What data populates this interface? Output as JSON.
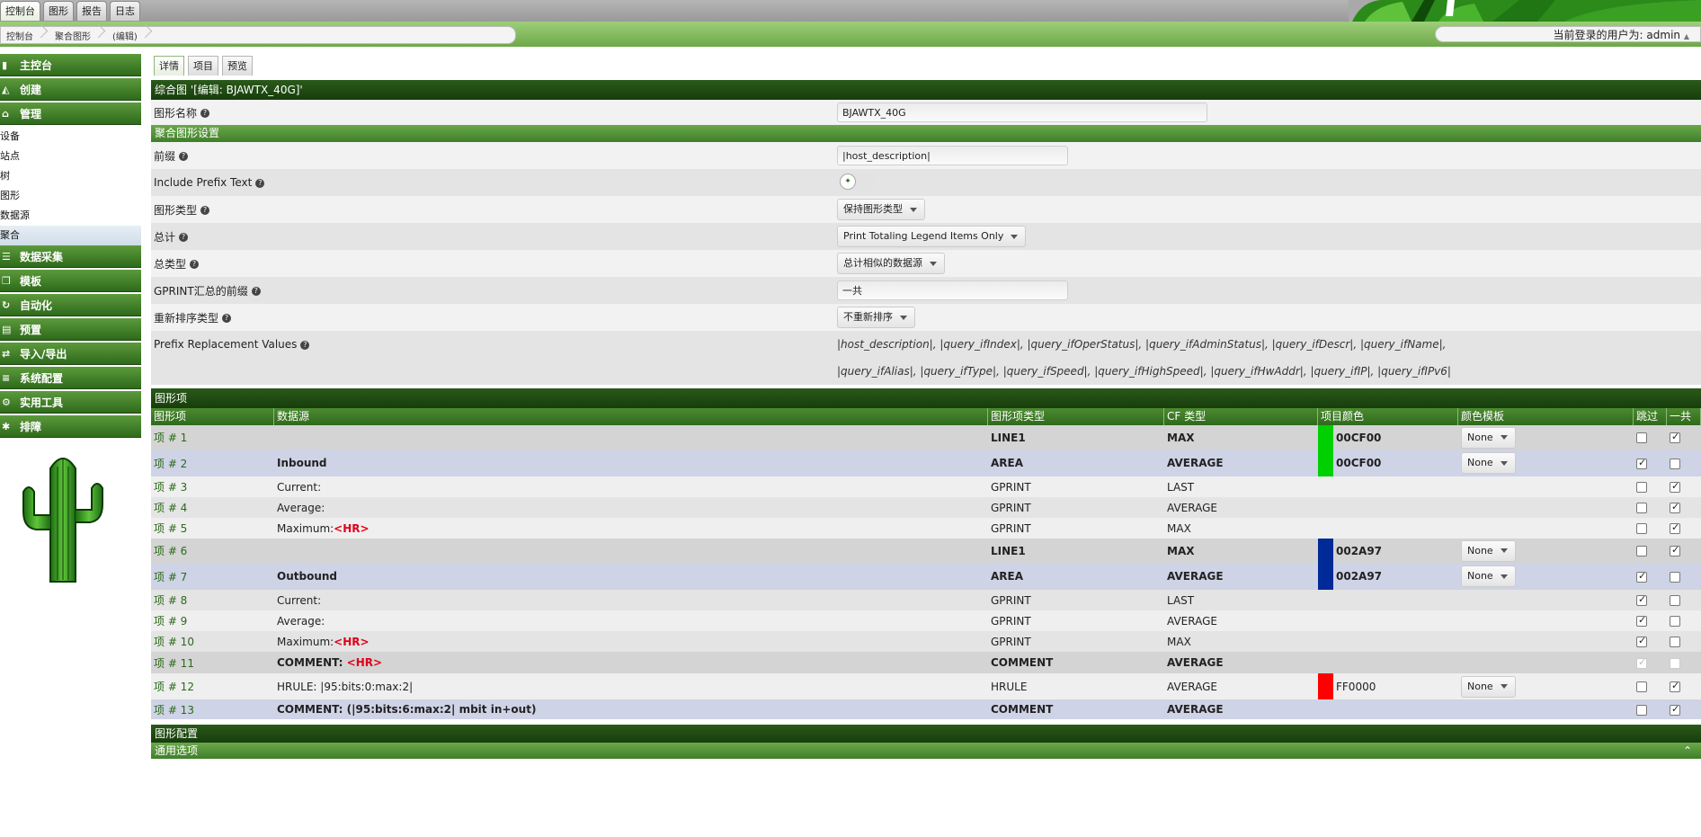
{
  "top_tabs": [
    "控制台",
    "图形",
    "报告",
    "日志"
  ],
  "breadcrumb": [
    "控制台",
    "聚合图形",
    "(编辑)"
  ],
  "user_text": "当前登录的用户为: admin",
  "sidebar": {
    "sections": [
      {
        "label": "主控台",
        "icon": "dashboard-icon"
      },
      {
        "label": "创建",
        "icon": "chart-icon"
      },
      {
        "label": "管理",
        "icon": "home-icon"
      }
    ],
    "manage_items": [
      "设备",
      "站点",
      "树",
      "图形",
      "数据源",
      "聚合"
    ],
    "sections2": [
      {
        "label": "数据采集",
        "icon": "database-icon"
      },
      {
        "label": "模板",
        "icon": "template-icon"
      },
      {
        "label": "自动化",
        "icon": "refresh-icon"
      },
      {
        "label": "预置",
        "icon": "preset-icon"
      },
      {
        "label": "导入/导出",
        "icon": "import-export-icon"
      },
      {
        "label": "系统配置",
        "icon": "config-icon"
      },
      {
        "label": "实用工具",
        "icon": "tools-icon"
      },
      {
        "label": "排障",
        "icon": "bug-icon"
      }
    ]
  },
  "content_tabs": [
    "详情",
    "项目",
    "预览"
  ],
  "page_header": "综合图 '[编辑: BJAWTX_40G]'",
  "graph_name": {
    "label": "图形名称",
    "value": "BJAWTX_40G"
  },
  "settings_header": "聚合图形设置",
  "fields": {
    "prefix": {
      "label": "前缀",
      "value": "|host_description|"
    },
    "include_prefix": {
      "label": "Include Prefix Text"
    },
    "graph_type": {
      "label": "图形类型",
      "value": "保持图形类型"
    },
    "total": {
      "label": "总计",
      "value": "Print Totaling Legend Items Only"
    },
    "total_type": {
      "label": "总类型",
      "value": "总计相似的数据源"
    },
    "gprint_prefix": {
      "label": "GPRINT汇总的前缀",
      "value": "一共"
    },
    "reorder": {
      "label": "重新排序类型",
      "value": "不重新排序"
    },
    "prefix_replacement": {
      "label": "Prefix Replacement Values",
      "line1": "|host_description|, |query_ifIndex|, |query_ifOperStatus|, |query_ifAdminStatus|, |query_ifDescr|, |query_ifName|,",
      "line2": "|query_ifAlias|, |query_ifType|, |query_ifSpeed|, |query_ifHighSpeed|, |query_ifHwAddr|, |query_ifIP|, |query_ifIPv6|"
    }
  },
  "items_header": "图形项",
  "items_columns": [
    "图形项",
    "数据源",
    "图形项类型",
    "CF 类型",
    "项目颜色",
    "颜色模板",
    "跳过",
    "一共"
  ],
  "items": [
    {
      "no": "项 # 1",
      "ds": "",
      "ds_red": "",
      "type": "LINE1",
      "cf": "MAX",
      "color": "00CF00",
      "hex": "#00CF00",
      "tpl": "None",
      "skip": false,
      "total": true
    },
    {
      "no": "项 # 2",
      "ds": "Inbound",
      "ds_red": "",
      "type": "AREA",
      "cf": "AVERAGE",
      "color": "00CF00",
      "hex": "#00CF00",
      "tpl": "None",
      "skip": true,
      "total": false
    },
    {
      "no": "项 # 3",
      "ds": "Current:",
      "ds_red": "",
      "type": "GPRINT",
      "cf": "LAST",
      "color": "",
      "hex": "",
      "tpl": "",
      "skip": false,
      "total": true
    },
    {
      "no": "项 # 4",
      "ds": "Average:",
      "ds_red": "",
      "type": "GPRINT",
      "cf": "AVERAGE",
      "color": "",
      "hex": "",
      "tpl": "",
      "skip": false,
      "total": true
    },
    {
      "no": "项 # 5",
      "ds": "Maximum:",
      "ds_red": "<HR>",
      "type": "GPRINT",
      "cf": "MAX",
      "color": "",
      "hex": "",
      "tpl": "",
      "skip": false,
      "total": true
    },
    {
      "no": "项 # 6",
      "ds": "",
      "ds_red": "",
      "type": "LINE1",
      "cf": "MAX",
      "color": "002A97",
      "hex": "#002A97",
      "tpl": "None",
      "skip": false,
      "total": true
    },
    {
      "no": "项 # 7",
      "ds": "Outbound",
      "ds_red": "",
      "type": "AREA",
      "cf": "AVERAGE",
      "color": "002A97",
      "hex": "#002A97",
      "tpl": "None",
      "skip": true,
      "total": false
    },
    {
      "no": "项 # 8",
      "ds": "Current:",
      "ds_red": "",
      "type": "GPRINT",
      "cf": "LAST",
      "color": "",
      "hex": "",
      "tpl": "",
      "skip": true,
      "total": false
    },
    {
      "no": "项 # 9",
      "ds": "Average:",
      "ds_red": "",
      "type": "GPRINT",
      "cf": "AVERAGE",
      "color": "",
      "hex": "",
      "tpl": "",
      "skip": true,
      "total": false
    },
    {
      "no": "项 # 10",
      "ds": "Maximum:",
      "ds_red": "<HR>",
      "type": "GPRINT",
      "cf": "MAX",
      "color": "",
      "hex": "",
      "tpl": "",
      "skip": true,
      "total": false
    },
    {
      "no": "项 # 11",
      "ds": "COMMENT: ",
      "ds_red": "<HR>",
      "type": "COMMENT",
      "cf": "AVERAGE",
      "color": "",
      "hex": "",
      "tpl": "",
      "skip": true,
      "total": false
    },
    {
      "no": "项 # 12",
      "ds": "HRULE: |95:bits:0:max:2|",
      "ds_red": "",
      "type": "HRULE",
      "cf": "AVERAGE",
      "color": "FF0000",
      "hex": "#FF0000",
      "tpl": "None",
      "skip": false,
      "total": true
    },
    {
      "no": "项 # 13",
      "ds": "COMMENT: (|95:bits:6:max:2| mbit in+out)",
      "ds_red": "",
      "type": "COMMENT",
      "cf": "AVERAGE",
      "color": "",
      "hex": "",
      "tpl": "",
      "skip": false,
      "total": true
    }
  ],
  "graph_config_header": "图形配置",
  "general_options_header": "通用选项"
}
